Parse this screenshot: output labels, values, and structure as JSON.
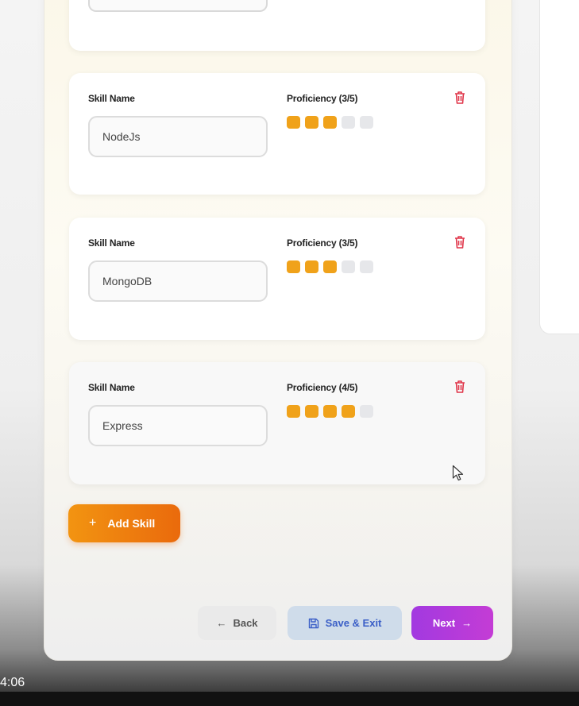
{
  "skills": [
    {
      "skill_label": "Skill Name",
      "proficiency_label": "Proficiency (3/5)",
      "name": "NodeJs",
      "proficiency": 3
    },
    {
      "skill_label": "Skill Name",
      "proficiency_label": "Proficiency (3/5)",
      "name": "MongoDB",
      "proficiency": 3
    },
    {
      "skill_label": "Skill Name",
      "proficiency_label": "Proficiency (4/5)",
      "name": "Express",
      "proficiency": 4
    }
  ],
  "proficiency_max": 5,
  "add_skill": {
    "icon": "plus-icon",
    "label": "Add Skill"
  },
  "footer": {
    "back": {
      "icon": "arrow-left-icon",
      "label": "Back"
    },
    "save_exit": {
      "icon": "floppy-disk-icon",
      "label": "Save & Exit"
    },
    "next": {
      "icon": "arrow-right-icon",
      "label": "Next"
    }
  },
  "video": {
    "timestamp": "4:06"
  },
  "colors": {
    "accent_orange": "#f0a21a",
    "add_button": "#ea6a0c",
    "next_button": "#a239e0",
    "save_button_text": "#3b5fc7",
    "trash": "#e0364a",
    "dot_empty": "#e6e7ea"
  }
}
